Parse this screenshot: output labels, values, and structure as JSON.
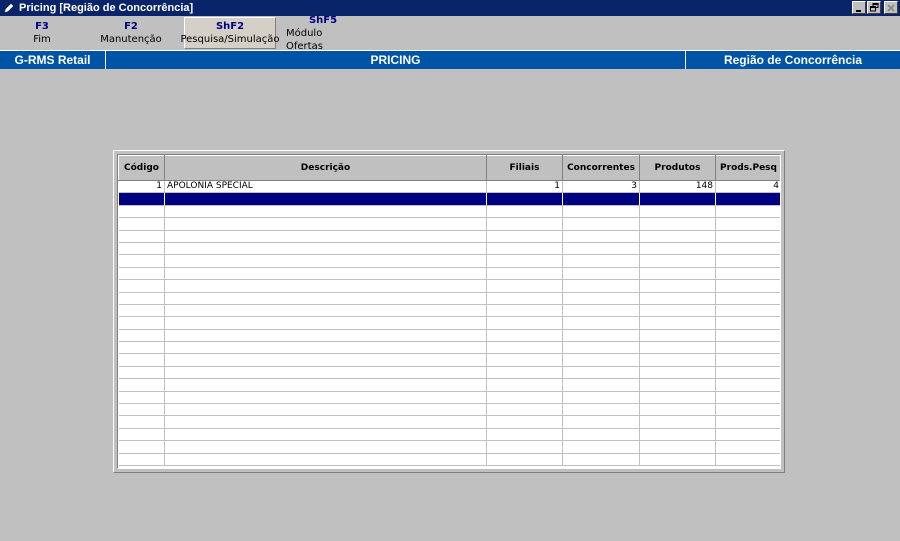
{
  "window": {
    "title": "Pricing  [Região de Concorrência]",
    "app_icon": "pencil-icon"
  },
  "fkeys": [
    {
      "key": "F3",
      "label": "Fim"
    },
    {
      "key": "F2",
      "label": "Manutenção"
    },
    {
      "key": "ShF2",
      "label": "Pesquisa/Simulação"
    },
    {
      "key": "ShF5",
      "label": "Módulo Ofertas"
    }
  ],
  "header": {
    "left": "G-RMS Retail",
    "center": "PRICING",
    "right": "Região de Concorrência"
  },
  "grid": {
    "columns": [
      "Código",
      "Descrição",
      "Filiais",
      "Concorrentes",
      "Produtos",
      "Prods.Pesq"
    ],
    "rows": [
      {
        "codigo": "1",
        "descricao": "APOLONIA SPECIAL",
        "filiais": "1",
        "concorrentes": "3",
        "produtos": "148",
        "prods_pesq": "4"
      }
    ],
    "selected_row_index": 1
  },
  "colors": {
    "titlebar": "#0a246a",
    "header_strip": "#0054a6",
    "selection": "#000080",
    "background": "#c0c0c0"
  }
}
